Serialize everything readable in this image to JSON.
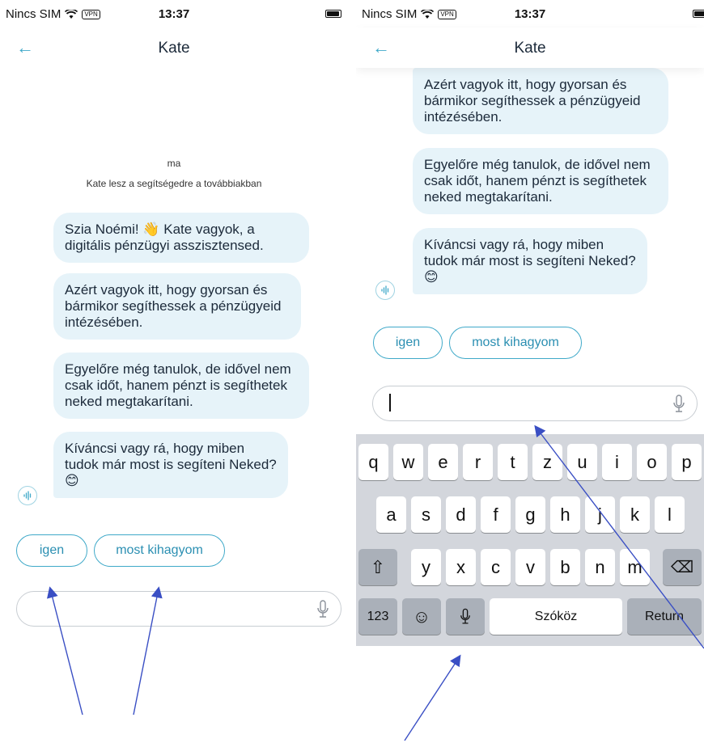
{
  "status": {
    "carrier": "Nincs SIM",
    "vpn": "VPN",
    "time": "13:37"
  },
  "header": {
    "back_icon": "←",
    "title": "Kate"
  },
  "chat": {
    "day": "ma",
    "intro": "Kate lesz a segítségedre a továbbiakban",
    "messages": [
      {
        "text": "Szia Noémi! 👋 Kate vagyok, a digitális pénzügyi asszisztensed."
      },
      {
        "text": "Azért vagyok itt, hogy gyorsan és bármikor segíthessek a pénzügyeid intézésében."
      },
      {
        "text": "Egyelőre még tanulok, de idővel nem csak időt, hanem pénzt is segíthetek neked megtakarítani."
      },
      {
        "text": "Kíváncsi vagy rá, hogy miben tudok már most is segíteni Neked? 😊"
      }
    ],
    "quick_replies": [
      "igen",
      "most kihagyom"
    ]
  },
  "input": {
    "placeholder": "",
    "mic_icon": "microphone-icon"
  },
  "keyboard": {
    "row1": [
      "q",
      "w",
      "e",
      "r",
      "t",
      "z",
      "u",
      "i",
      "o",
      "p"
    ],
    "row2": [
      "a",
      "s",
      "d",
      "f",
      "g",
      "h",
      "j",
      "k",
      "l"
    ],
    "row3": [
      "y",
      "x",
      "c",
      "v",
      "b",
      "n",
      "m"
    ],
    "shift": "⇧",
    "backspace": "⌫",
    "numbers": "123",
    "emoji": "☺",
    "space": "Szóköz",
    "return": "Return"
  },
  "colors": {
    "accent": "#3fa9c9",
    "bubble": "#e6f3f9",
    "arrow": "#3a4fc4"
  }
}
